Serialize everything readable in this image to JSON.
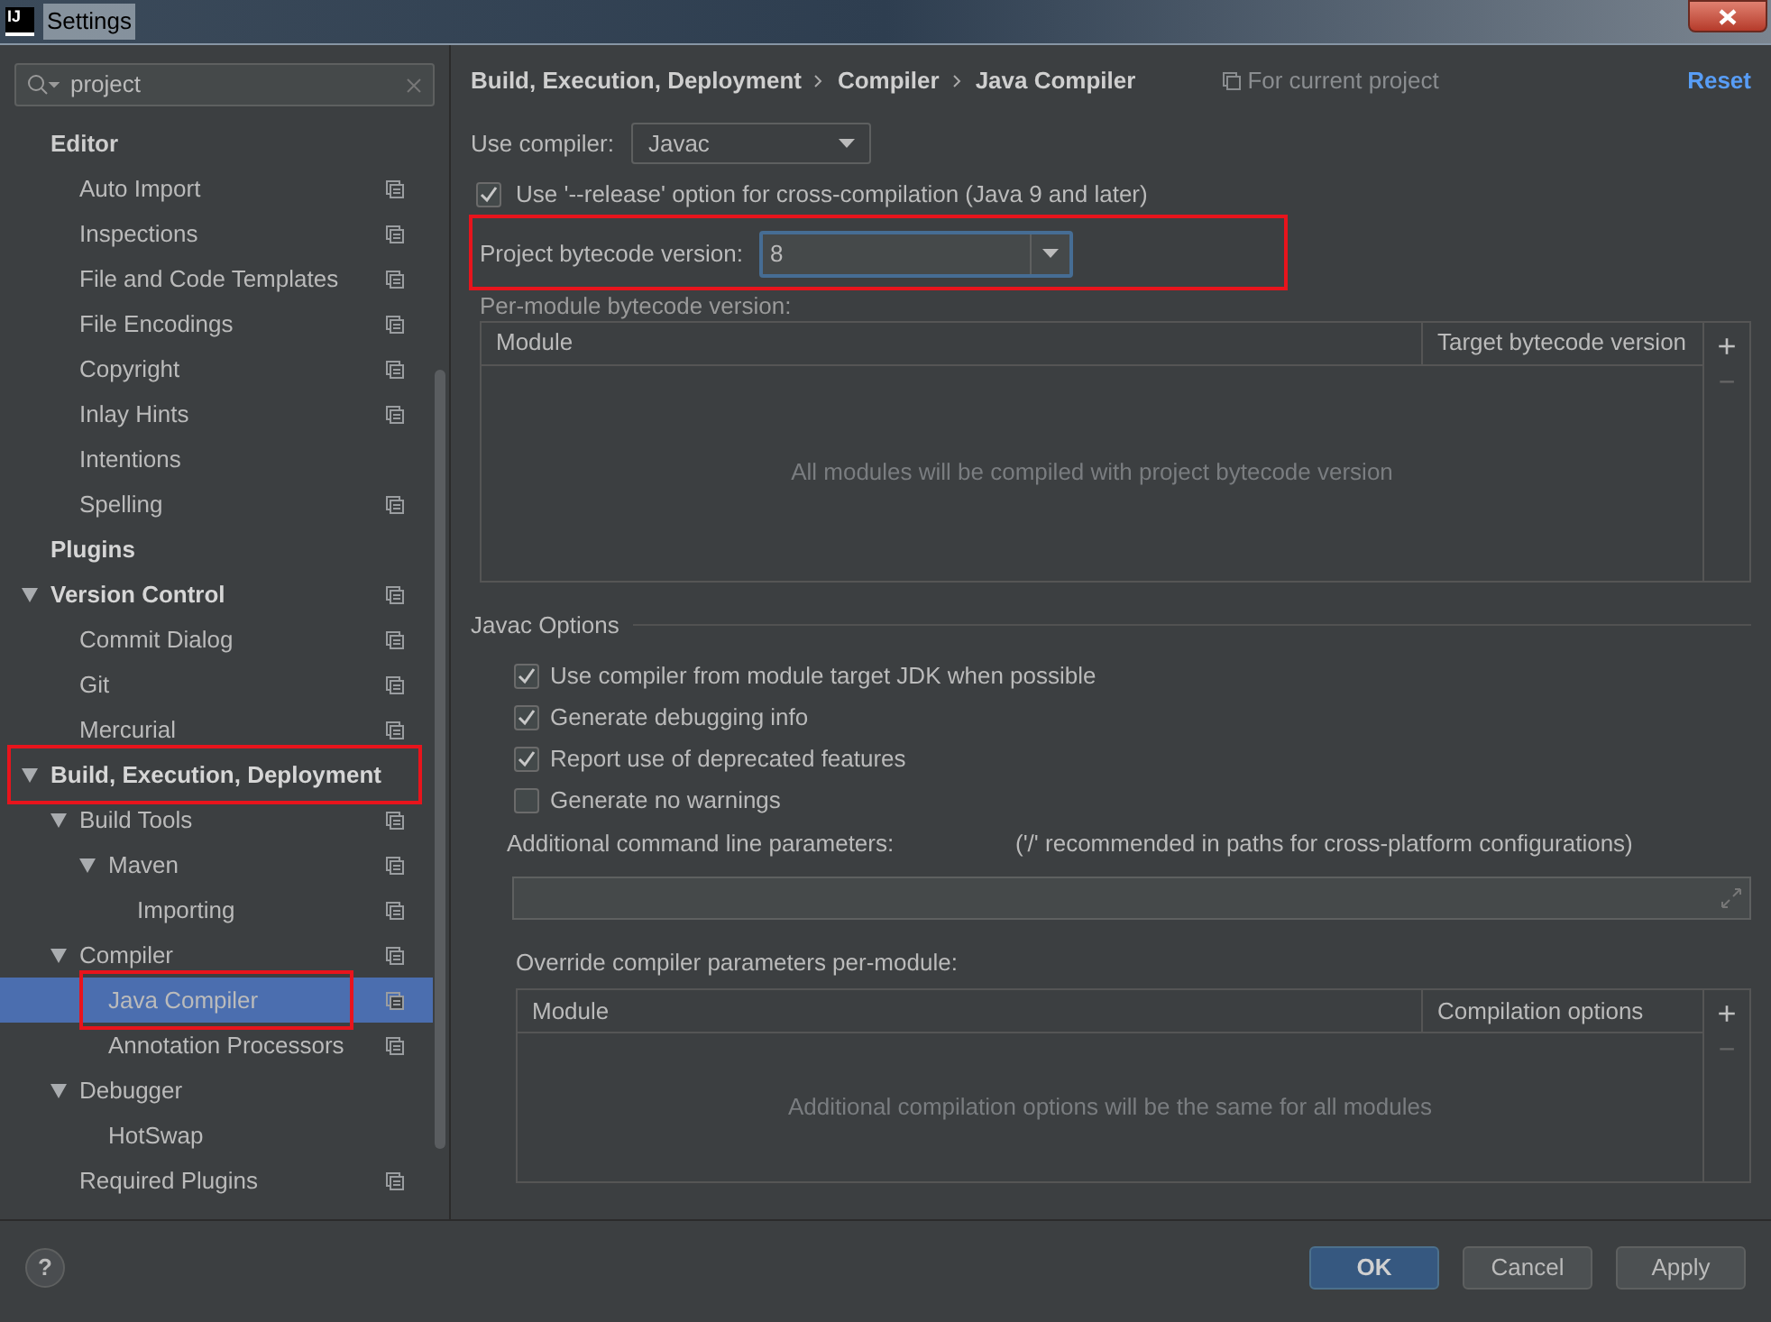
{
  "window": {
    "logo": "IJ",
    "title": "Settings"
  },
  "search": {
    "value": "project"
  },
  "tree": [
    {
      "label": "Editor",
      "kind": "header",
      "children": [
        {
          "label": "Auto Import",
          "project_level": true,
          "selected": false
        },
        {
          "label": "Inspections",
          "project_level": true,
          "selected": false
        },
        {
          "label": "File and Code Templates",
          "project_level": true,
          "selected": false
        },
        {
          "label": "File Encodings",
          "project_level": true,
          "selected": false
        },
        {
          "label": "Copyright",
          "project_level": true,
          "selected": false
        },
        {
          "label": "Inlay Hints",
          "project_level": true,
          "selected": false
        },
        {
          "label": "Intentions",
          "project_level": false,
          "selected": false
        },
        {
          "label": "Spelling",
          "project_level": true,
          "selected": false
        }
      ]
    },
    {
      "label": "Plugins",
      "kind": "section",
      "project_level": false,
      "selected": false
    },
    {
      "label": "Version Control",
      "kind": "section",
      "expanded": true,
      "project_level": true,
      "selected": false,
      "children": [
        {
          "label": "Commit Dialog",
          "project_level": true,
          "selected": false
        },
        {
          "label": "Git",
          "project_level": true,
          "selected": false
        },
        {
          "label": "Mercurial",
          "project_level": true,
          "selected": false
        }
      ]
    },
    {
      "label": "Build, Execution, Deployment",
      "kind": "section",
      "expanded": true,
      "project_level": false,
      "selected": false,
      "annotated": true,
      "children": [
        {
          "label": "Build Tools",
          "expanded": true,
          "project_level": true,
          "selected": false,
          "children": [
            {
              "label": "Maven",
              "expanded": true,
              "project_level": true,
              "selected": false,
              "children": [
                {
                  "label": "Importing",
                  "project_level": true,
                  "selected": false
                }
              ]
            }
          ]
        },
        {
          "label": "Compiler",
          "expanded": true,
          "project_level": true,
          "selected": false,
          "children": [
            {
              "label": "Java Compiler",
              "project_level": true,
              "selected": true,
              "annotated": true
            },
            {
              "label": "Annotation Processors",
              "project_level": true,
              "selected": false
            }
          ]
        },
        {
          "label": "Debugger",
          "expanded": true,
          "project_level": false,
          "selected": false,
          "children": [
            {
              "label": "HotSwap",
              "project_level": false,
              "selected": false
            }
          ]
        },
        {
          "label": "Required Plugins",
          "project_level": true,
          "selected": false
        }
      ]
    }
  ],
  "breadcrumb": [
    "Build, Execution, Deployment",
    "Compiler",
    "Java Compiler"
  ],
  "scope": "For current project",
  "reset": "Reset",
  "use_compiler": {
    "label": "Use compiler:",
    "value": "Javac"
  },
  "release_option": {
    "label": "Use '--release' option for cross-compilation (Java 9 and later)",
    "checked": true
  },
  "bytecode": {
    "label": "Project bytecode version:",
    "value": "8",
    "annotated": true
  },
  "per_module": {
    "label": "Per-module bytecode version:",
    "columns": [
      "Module",
      "Target bytecode version"
    ],
    "empty": "All modules will be compiled with project bytecode version",
    "add": "+",
    "remove": "−"
  },
  "javac": {
    "title": "Javac Options",
    "options": [
      {
        "label": "Use compiler from module target JDK when possible",
        "checked": true
      },
      {
        "label": "Generate debugging info",
        "checked": true
      },
      {
        "label": "Report use of deprecated features",
        "checked": true
      },
      {
        "label": "Generate no warnings",
        "checked": false
      }
    ],
    "params_label": "Additional command line parameters:",
    "params_hint": "('/' recommended in paths for cross-platform configurations)"
  },
  "override": {
    "label": "Override compiler parameters per-module:",
    "columns": [
      "Module",
      "Compilation options"
    ],
    "empty": "Additional compilation options will be the same for all modules",
    "add": "+",
    "remove": "−"
  },
  "help": "?",
  "buttons": [
    {
      "label": "OK",
      "default": true
    },
    {
      "label": "Cancel",
      "default": false
    },
    {
      "label": "Apply",
      "default": false
    }
  ]
}
